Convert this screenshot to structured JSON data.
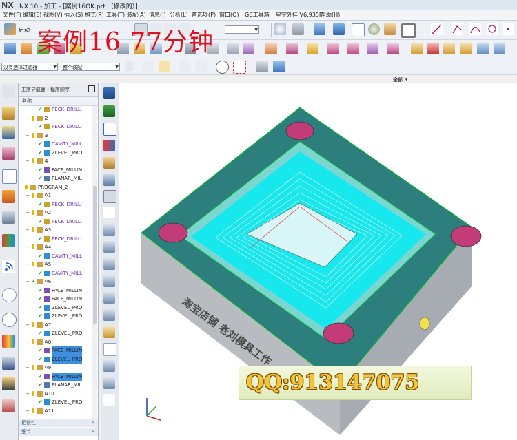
{
  "window": {
    "logo": "NX",
    "title": "NX 10 - 加工 - [案例16OK.prt （修改的）]"
  },
  "menu": [
    "文件(F)",
    "编辑(E)",
    "视图(V)",
    "插入(S)",
    "格式(R)",
    "工具(T)",
    "装配(A)",
    "信息(I)",
    "分析(L)",
    "首选项(P)",
    "窗口(O)",
    "GC工具箱",
    "星空外挂 V6.935F",
    "帮助(H)"
  ],
  "toolbar": {
    "start_label": "启动",
    "overlay_title": "案例16   77分钟",
    "filter_combo": "没有选择过滤器",
    "assembly_combo": "整个装配"
  },
  "navigator": {
    "title": "工序导航器 - 程序顺序",
    "column_name": "名称",
    "rows": [
      {
        "label": "PECK_DRILLI",
        "type": "op-drill",
        "status": "check"
      },
      {
        "label": "2",
        "type": "group",
        "status": "none"
      },
      {
        "label": "PECK_DRILLI",
        "type": "op-drill",
        "status": "check"
      },
      {
        "label": "3",
        "type": "group",
        "status": "none"
      },
      {
        "label": "CAVITY_MILL",
        "type": "op-cavity",
        "status": "check"
      },
      {
        "label": "ZLEVEL_PRO",
        "type": "op-zlevel",
        "status": "check"
      },
      {
        "label": "4",
        "type": "group",
        "status": "none"
      },
      {
        "label": "FACE_MILLIN",
        "type": "op-face",
        "status": "check"
      },
      {
        "label": "PLANAR_MIL",
        "type": "op-planar",
        "status": "check"
      },
      {
        "label": "PROGRAM_2",
        "type": "program",
        "status": "none"
      },
      {
        "label": "A1",
        "type": "group",
        "status": "none"
      },
      {
        "label": "PECK_DRILLI",
        "type": "op-drill",
        "status": "check"
      },
      {
        "label": "A2",
        "type": "group",
        "status": "none"
      },
      {
        "label": "PECK_DRILLI",
        "type": "op-drill",
        "status": "check"
      },
      {
        "label": "A3",
        "type": "group",
        "status": "none"
      },
      {
        "label": "PECK_DRILLI",
        "type": "op-drill",
        "status": "check"
      },
      {
        "label": "A4",
        "type": "group",
        "status": "none"
      },
      {
        "label": "CAVITY_MILL",
        "type": "op-cavity",
        "status": "check"
      },
      {
        "label": "A5",
        "type": "group",
        "status": "none"
      },
      {
        "label": "CAVITY_MILL",
        "type": "op-cavity",
        "status": "check"
      },
      {
        "label": "A6",
        "type": "group",
        "status": "check"
      },
      {
        "label": "FACE_MILLIN",
        "type": "op-face",
        "status": "check"
      },
      {
        "label": "FACE_MILLIN",
        "type": "op-face",
        "status": "check"
      },
      {
        "label": "ZLEVEL_PRO",
        "type": "op-zlevel",
        "status": "check"
      },
      {
        "label": "ZLEVEL_PRO",
        "type": "op-zlevel",
        "status": "check"
      },
      {
        "label": "A7",
        "type": "group",
        "status": "none"
      },
      {
        "label": "ZLEVEL_PRO",
        "type": "op-zlevel",
        "status": "check"
      },
      {
        "label": "A8",
        "type": "group",
        "status": "none"
      },
      {
        "label": "FACE_MILLIN",
        "type": "op-face",
        "status": "check",
        "selected": true
      },
      {
        "label": "ZLEVEL_PRO",
        "type": "op-zlevel",
        "status": "check",
        "selected": true
      },
      {
        "label": "A9",
        "type": "group",
        "status": "none"
      },
      {
        "label": "FACE_MILLIN",
        "type": "op-face",
        "status": "check",
        "selected": true
      },
      {
        "label": "PLANAR_MIL",
        "type": "op-planar",
        "status": "check"
      },
      {
        "label": "A10",
        "type": "group",
        "status": "none"
      },
      {
        "label": "ZLEVEL_PRO",
        "type": "op-zlevel",
        "status": "check"
      },
      {
        "label": "A11",
        "type": "group",
        "status": "none"
      }
    ],
    "dependencies_label": "相依性",
    "details_label": "细节"
  },
  "viewport": {
    "label": "全部 3",
    "part_engraving": "淘宝店铺   老刘模具工作",
    "watermark": "QQ:913147075",
    "colors": {
      "part_top": "#2c7f7c",
      "part_side": "#b8bcc0",
      "cavity": "#16e8ee",
      "hole": "#c23c7a",
      "background": "#ffffff"
    }
  }
}
